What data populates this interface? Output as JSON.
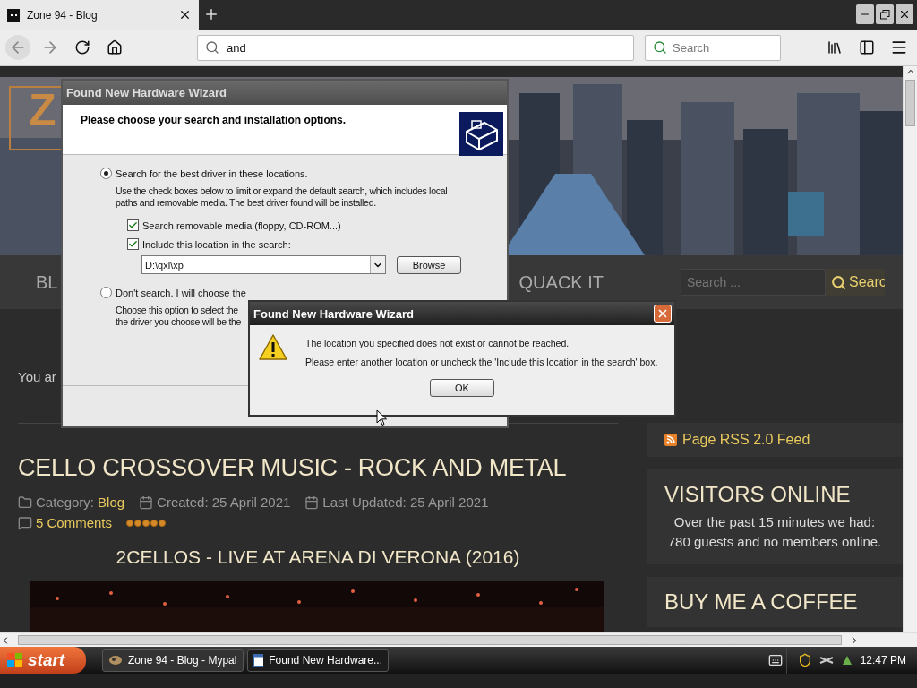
{
  "browser": {
    "tabs": [
      {
        "title": "Zone 94 - Blog",
        "selected": true
      }
    ],
    "address": "and",
    "search_placeholder": "Search"
  },
  "site": {
    "logo": "Z",
    "nav": [
      {
        "label": "BL"
      },
      {
        "label": "QUACK IT"
      }
    ],
    "search": {
      "placeholder": "Search ...",
      "button": "Searc"
    },
    "breadcrumb": "You ar",
    "article": {
      "title": "CELLO CROSSOVER MUSIC - ROCK AND METAL",
      "meta": [
        {
          "kind": "category",
          "label": "Category:",
          "value": "Blog"
        },
        {
          "kind": "date",
          "label": "Created: 25 April 2021"
        },
        {
          "kind": "date",
          "label": "Last Updated: 25 April 2021"
        }
      ],
      "comments": "5 Comments",
      "stars": 5,
      "subtitle": "2CELLOS - LIVE AT ARENA DI VERONA (2016)"
    },
    "sidebar": [
      {
        "kind": "rss",
        "text": "Page RSS 2.0 Feed"
      },
      {
        "kind": "module",
        "title": "VISITORS ONLINE",
        "body": "Over the past 15 minutes we had: 780 guests and no members online."
      },
      {
        "kind": "module",
        "title": "BUY ME A COFFEE"
      }
    ]
  },
  "wizard": {
    "title": "Found New Hardware Wizard",
    "heading": "Please choose your search and installation options.",
    "options": [
      {
        "label": "Search for the best driver in these locations.",
        "selected": true,
        "lines": [
          "Use the check boxes below to limit or expand the default search, which includes local",
          "paths and removable media. The best driver found will be installed."
        ]
      },
      {
        "label": "Don't search. I will choose the",
        "selected": false,
        "lines": [
          "Choose this option to select the",
          "the driver you choose will be the"
        ]
      }
    ],
    "checkboxes": [
      {
        "label": "Search removable media (floppy, CD-ROM...)",
        "checked": true
      },
      {
        "label": "Include this location in the search:",
        "checked": true
      }
    ],
    "path": "D:\\qxl\\xp",
    "browse": "Browse"
  },
  "alert": {
    "title": "Found New Hardware Wizard",
    "messages": [
      "The location you specified does not exist or cannot be reached.",
      "Please enter another location or uncheck the 'Include this location in the search' box."
    ],
    "ok": "OK"
  },
  "taskbar": {
    "start": "start",
    "tasks": [
      {
        "label": "Zone 94 - Blog - Mypal",
        "selected": false
      },
      {
        "label": "Found New Hardware...",
        "selected": true
      }
    ],
    "clock": "12:47 PM"
  }
}
